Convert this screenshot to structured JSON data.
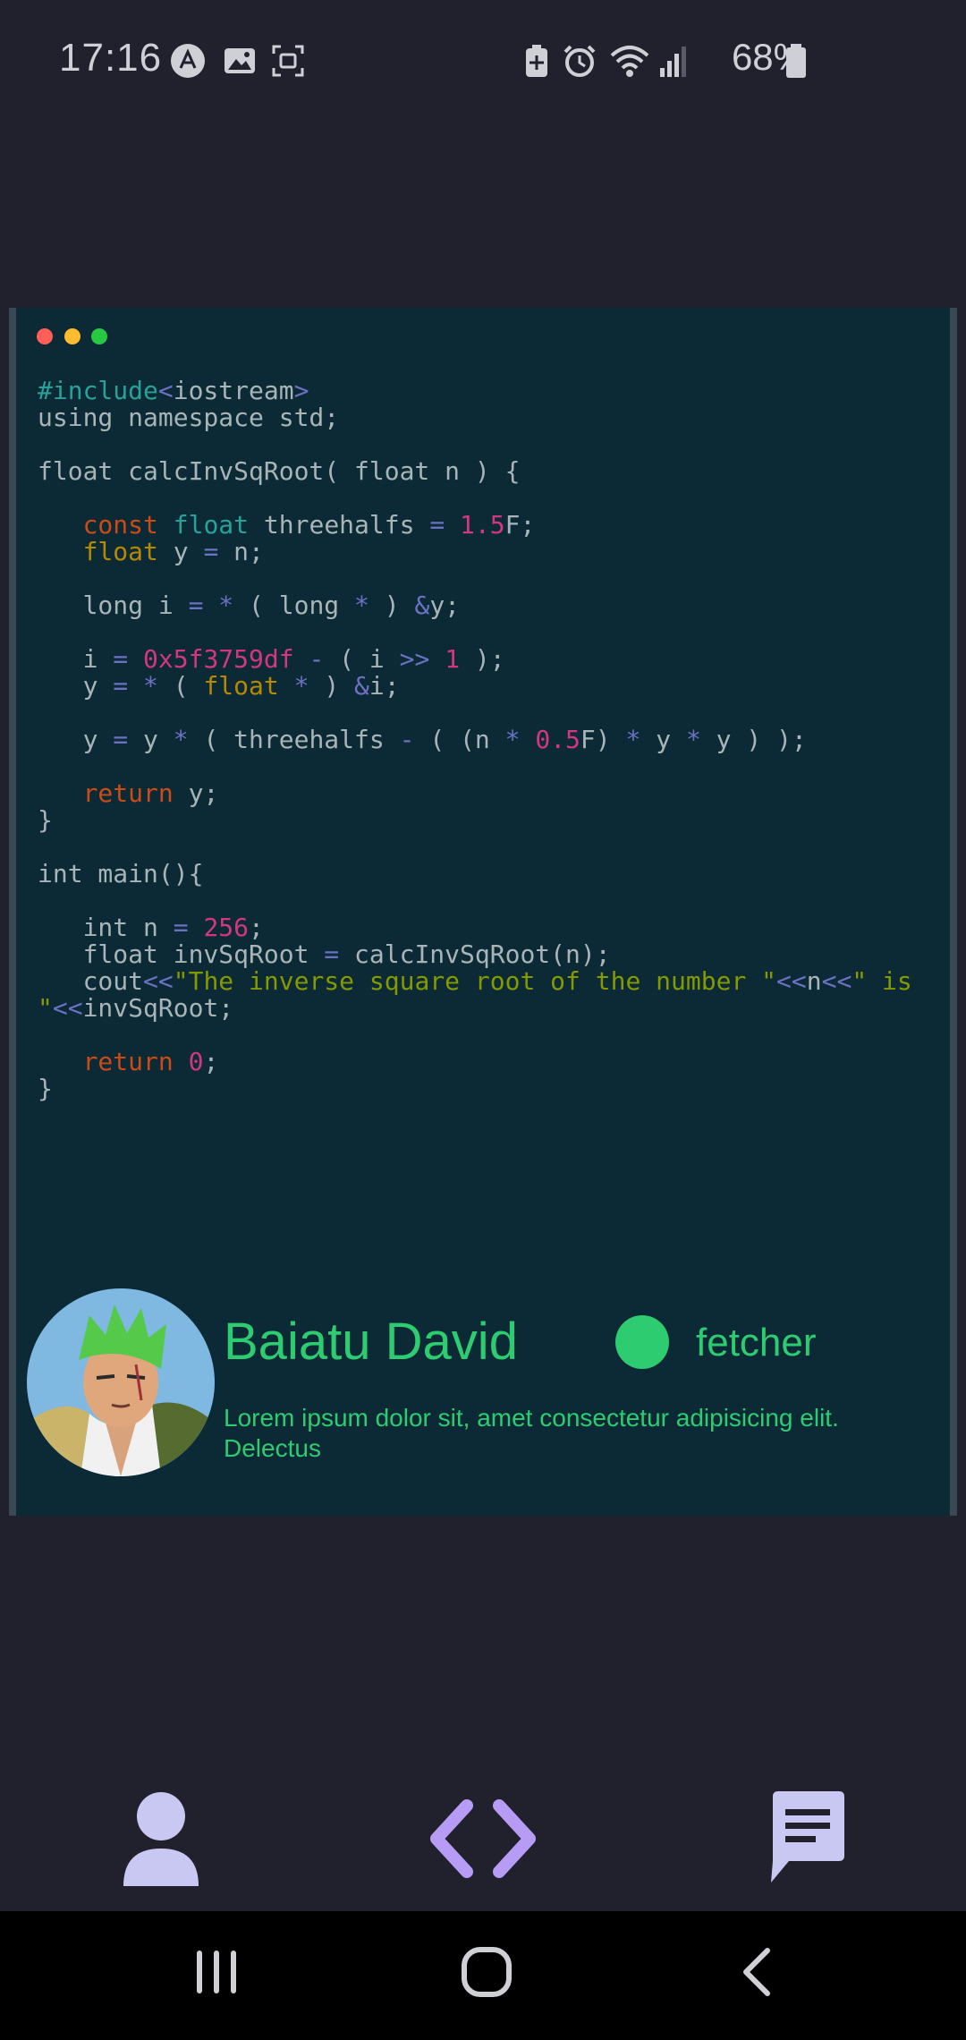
{
  "status_bar": {
    "time": "17:16",
    "battery": "68%",
    "icons_left": [
      "autofill-icon",
      "gallery-icon",
      "screenshot-icon"
    ],
    "icons_right": [
      "battery-saver-icon",
      "alarm-icon",
      "wifi-icon",
      "signal-icon",
      "battery-icon"
    ]
  },
  "code_window": {
    "dots": [
      {
        "name": "close-dot",
        "color": "#ff5f57"
      },
      {
        "name": "minimize-dot",
        "color": "#febc2e"
      },
      {
        "name": "maximize-dot",
        "color": "#28c840"
      }
    ],
    "lines": [
      {
        "tokens": [
          {
            "t": "#include",
            "c": "include"
          },
          {
            "t": "<",
            "c": "ang"
          },
          {
            "t": "iostream",
            "c": ""
          },
          {
            "t": ">",
            "c": "ang"
          }
        ]
      },
      {
        "tokens": [
          {
            "t": "using namespace std;",
            "c": ""
          }
        ]
      },
      {
        "tokens": []
      },
      {
        "tokens": [
          {
            "t": "float calcInvSqRoot( float n ) {",
            "c": ""
          }
        ]
      },
      {
        "tokens": []
      },
      {
        "tokens": [
          {
            "t": "   ",
            "c": ""
          },
          {
            "t": "const",
            "c": "orange"
          },
          {
            "t": " ",
            "c": ""
          },
          {
            "t": "float",
            "c": "teal"
          },
          {
            "t": " threehalfs ",
            "c": ""
          },
          {
            "t": "=",
            "c": "op"
          },
          {
            "t": " ",
            "c": ""
          },
          {
            "t": "1.5",
            "c": "num"
          },
          {
            "t": "F;",
            "c": ""
          }
        ]
      },
      {
        "tokens": [
          {
            "t": "   ",
            "c": ""
          },
          {
            "t": "float",
            "c": "yellow"
          },
          {
            "t": " y ",
            "c": ""
          },
          {
            "t": "=",
            "c": "op"
          },
          {
            "t": " n;",
            "c": ""
          }
        ]
      },
      {
        "tokens": []
      },
      {
        "tokens": [
          {
            "t": "   long i ",
            "c": ""
          },
          {
            "t": "=",
            "c": "op"
          },
          {
            "t": " ",
            "c": ""
          },
          {
            "t": "*",
            "c": "op"
          },
          {
            "t": " ( long ",
            "c": ""
          },
          {
            "t": "*",
            "c": "op"
          },
          {
            "t": " ) ",
            "c": ""
          },
          {
            "t": "&",
            "c": "op"
          },
          {
            "t": "y;",
            "c": ""
          }
        ]
      },
      {
        "tokens": []
      },
      {
        "tokens": [
          {
            "t": "   i ",
            "c": ""
          },
          {
            "t": "=",
            "c": "op"
          },
          {
            "t": " ",
            "c": ""
          },
          {
            "t": "0x5f3759df",
            "c": "num"
          },
          {
            "t": " ",
            "c": ""
          },
          {
            "t": "-",
            "c": "op"
          },
          {
            "t": " ( i ",
            "c": ""
          },
          {
            "t": ">>",
            "c": "op"
          },
          {
            "t": " ",
            "c": ""
          },
          {
            "t": "1",
            "c": "num"
          },
          {
            "t": " );",
            "c": ""
          }
        ]
      },
      {
        "tokens": [
          {
            "t": "   y ",
            "c": ""
          },
          {
            "t": "=",
            "c": "op"
          },
          {
            "t": " ",
            "c": ""
          },
          {
            "t": "*",
            "c": "op"
          },
          {
            "t": " ( ",
            "c": ""
          },
          {
            "t": "float",
            "c": "yellow"
          },
          {
            "t": " ",
            "c": ""
          },
          {
            "t": "*",
            "c": "op"
          },
          {
            "t": " ) ",
            "c": ""
          },
          {
            "t": "&",
            "c": "op"
          },
          {
            "t": "i;",
            "c": ""
          }
        ]
      },
      {
        "tokens": []
      },
      {
        "tokens": [
          {
            "t": "   y ",
            "c": ""
          },
          {
            "t": "=",
            "c": "op"
          },
          {
            "t": " y ",
            "c": ""
          },
          {
            "t": "*",
            "c": "op"
          },
          {
            "t": " ( threehalfs ",
            "c": ""
          },
          {
            "t": "-",
            "c": "op"
          },
          {
            "t": " ( (n ",
            "c": ""
          },
          {
            "t": "*",
            "c": "op"
          },
          {
            "t": " ",
            "c": ""
          },
          {
            "t": "0.5",
            "c": "num"
          },
          {
            "t": "F) ",
            "c": ""
          },
          {
            "t": "*",
            "c": "op"
          },
          {
            "t": " y ",
            "c": ""
          },
          {
            "t": "*",
            "c": "op"
          },
          {
            "t": " y ) );",
            "c": ""
          }
        ]
      },
      {
        "tokens": []
      },
      {
        "tokens": [
          {
            "t": "   ",
            "c": ""
          },
          {
            "t": "return",
            "c": "orange"
          },
          {
            "t": " y;",
            "c": ""
          }
        ]
      },
      {
        "tokens": [
          {
            "t": "}",
            "c": ""
          }
        ]
      },
      {
        "tokens": []
      },
      {
        "tokens": [
          {
            "t": "int main(){",
            "c": ""
          }
        ]
      },
      {
        "tokens": []
      },
      {
        "tokens": [
          {
            "t": "   int n ",
            "c": ""
          },
          {
            "t": "=",
            "c": "op"
          },
          {
            "t": " ",
            "c": ""
          },
          {
            "t": "256",
            "c": "num"
          },
          {
            "t": ";",
            "c": ""
          }
        ]
      },
      {
        "tokens": [
          {
            "t": "   float invSqRoot ",
            "c": ""
          },
          {
            "t": "=",
            "c": "op"
          },
          {
            "t": " calcInvSqRoot(n);",
            "c": ""
          }
        ]
      },
      {
        "tokens": [
          {
            "t": "   cout",
            "c": ""
          },
          {
            "t": "<<",
            "c": "op"
          },
          {
            "t": "\"The inverse square root of the number \"",
            "c": "str"
          },
          {
            "t": "<<",
            "c": "op"
          },
          {
            "t": "n",
            "c": ""
          },
          {
            "t": "<<",
            "c": "op"
          },
          {
            "t": "\" is",
            "c": "str"
          }
        ]
      },
      {
        "tokens": [
          {
            "t": "\"",
            "c": "str"
          },
          {
            "t": "<<",
            "c": "op"
          },
          {
            "t": "invSqRoot;",
            "c": ""
          }
        ]
      },
      {
        "tokens": []
      },
      {
        "tokens": [
          {
            "t": "   ",
            "c": ""
          },
          {
            "t": "return",
            "c": "orange"
          },
          {
            "t": " ",
            "c": ""
          },
          {
            "t": "0",
            "c": "num"
          },
          {
            "t": ";",
            "c": ""
          }
        ]
      },
      {
        "tokens": [
          {
            "t": "}",
            "c": ""
          }
        ]
      }
    ]
  },
  "profile": {
    "name": "Baiatu David",
    "role": "fetcher",
    "description": "Lorem ipsum dolor sit, amet consectetur adipisicing elit. Delectus",
    "status_color": "#2ecc71",
    "avatar": "profile-avatar-image"
  },
  "bottom_nav": {
    "items": [
      {
        "name": "profile-nav-button",
        "icon": "person-icon",
        "color": "#c9c8f2"
      },
      {
        "name": "code-nav-button",
        "icon": "code-icon",
        "color": "#b79cf5"
      },
      {
        "name": "chat-nav-button",
        "icon": "chat-icon",
        "color": "#c9c8f2"
      }
    ]
  },
  "system_nav": {
    "items": [
      "recents-icon",
      "home-icon",
      "back-icon"
    ]
  }
}
